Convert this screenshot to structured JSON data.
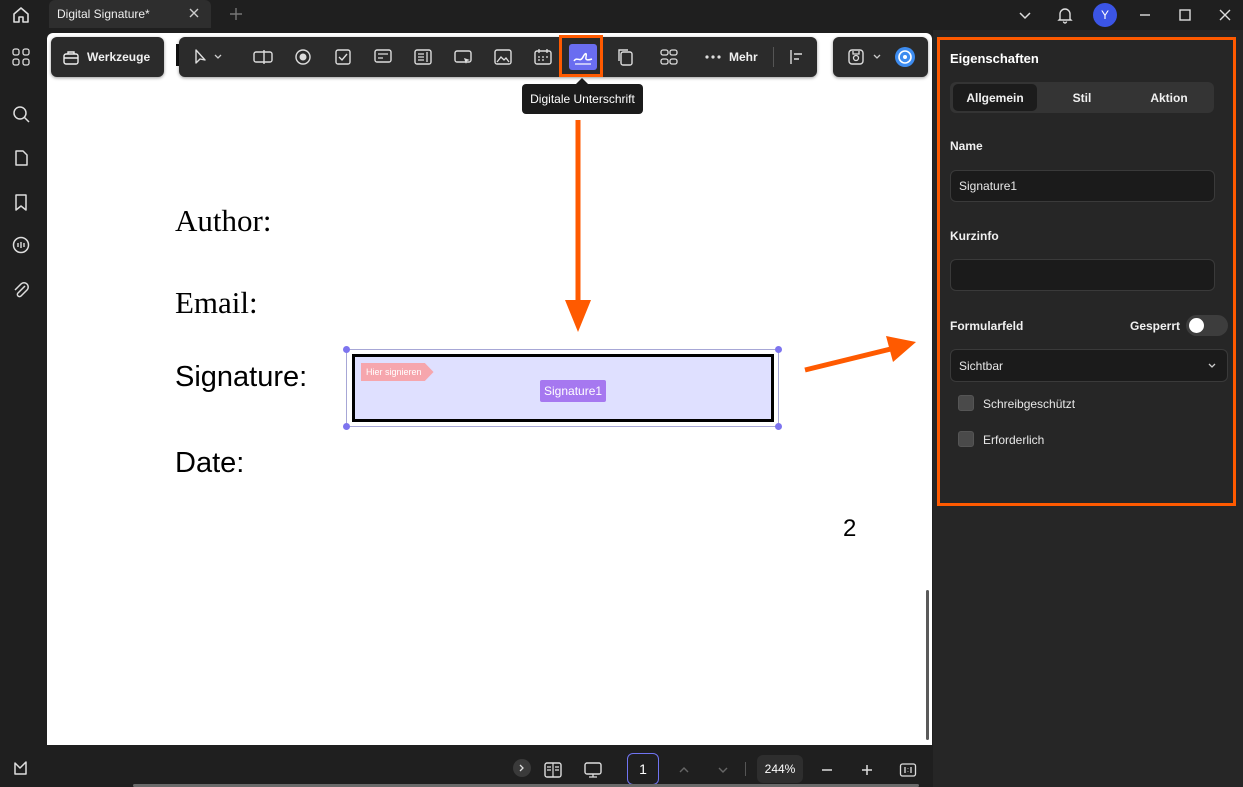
{
  "titlebar": {
    "tab_title": "Digital Signature*",
    "avatar_initial": "Y"
  },
  "toolbar": {
    "tools_label": "Werkzeuge",
    "more_label": "Mehr",
    "tooltip": "Digitale Unterschrift",
    "active_tool": "digital-signature"
  },
  "document": {
    "author_label": "Author:",
    "email_label": "Email:",
    "signature_label": "Signature:",
    "date_label": "Date:",
    "page_number": "2",
    "sign_tag": "Hier signieren",
    "field_name": "Signature1"
  },
  "panel": {
    "title": "Eigenschaften",
    "tabs": [
      {
        "label": "Allgemein",
        "active": true
      },
      {
        "label": "Stil",
        "active": false
      },
      {
        "label": "Aktion",
        "active": false
      }
    ],
    "name_label": "Name",
    "name_value": "Signature1",
    "tooltip_label": "Kurzinfo",
    "tooltip_value": "",
    "formfield_label": "Formularfeld",
    "locked_label": "Gesperrt",
    "locked_on": false,
    "visibility_value": "Sichtbar",
    "readonly_label": "Schreibgeschützt",
    "readonly_checked": false,
    "required_label": "Erforderlich",
    "required_checked": false
  },
  "statusbar": {
    "current_page": "1",
    "zoom": "244%"
  },
  "colors": {
    "accent": "#6a6df0",
    "highlight": "#ff5a00",
    "field_fill": "#dfe0ff",
    "field_name_tag": "#a678f0",
    "sign_tag": "#f6a6ad"
  }
}
